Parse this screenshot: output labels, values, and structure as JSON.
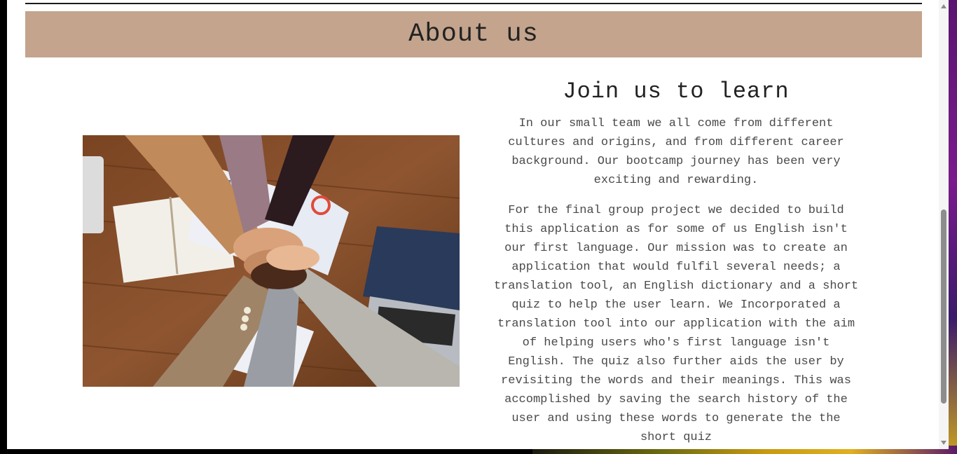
{
  "page": {
    "banner_title": "About us"
  },
  "about": {
    "heading": "Join us to learn",
    "paragraph_1": "In our small team we all come from different cultures and origins, and from different career background. Our bootcamp journey has been very exciting and rewarding.",
    "paragraph_2": "For the final group project we decided to build this application as for some of us English isn't our first language. Our mission was to create an application that would fulfil several needs; a translation tool, an English dictionary and a short quiz to help the user learn. We Incorporated a translation tool into our application with the aim of helping users who's first language isn't English. The quiz also further aids the user by revisiting the words and their meanings. This was accomplished by saving the search history of the user and using these words to generate the the short quiz"
  },
  "image": {
    "semantic": "team-hands-stacked-photo"
  },
  "colors": {
    "banner_bg": "#c4a48d",
    "page_bg": "#ffffff",
    "heading_text": "#222222",
    "body_text": "#4a4a4a"
  },
  "scrollbar": {
    "position_fraction": 0.47
  }
}
